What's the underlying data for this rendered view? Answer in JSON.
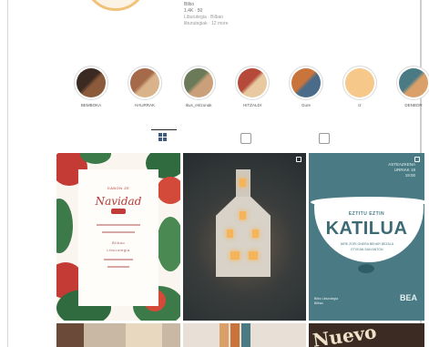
{
  "profile": {
    "name": "Bilbo",
    "stats": "1.4K · 50",
    "bio": "Liburutegia · Bilbao",
    "followed_by": "liburutegiak · 12 more"
  },
  "highlights": [
    {
      "label": "BEMBOKA",
      "icon": "highlight-cover",
      "colors": [
        "#3a2a22",
        "#8a5a3a"
      ]
    },
    {
      "label": "HAURRAK",
      "icon": "highlight-cover",
      "colors": [
        "#a46a4a",
        "#d9b48a"
      ]
    },
    {
      "label": "Ikus_entzunak",
      "icon": "highlight-cover",
      "colors": [
        "#6b7b5a",
        "#c9a07a"
      ]
    },
    {
      "label": "HITZALDI",
      "icon": "highlight-cover",
      "colors": [
        "#b54a3a",
        "#e8c9a0"
      ]
    },
    {
      "label": "Gure",
      "icon": "highlight-cover",
      "colors": [
        "#c9743a",
        "#4a6b8a"
      ]
    },
    {
      "label": "Iz",
      "icon": "highlight-cover",
      "colors": [
        "#f6c98a",
        "#f6c98a"
      ]
    },
    {
      "label": "DENBOR",
      "icon": "highlight-cover",
      "colors": [
        "#4a7b85",
        "#d9a06a"
      ]
    }
  ],
  "tabs": [
    {
      "name": "posts",
      "icon": "grid-icon",
      "active": true
    },
    {
      "name": "reels",
      "icon": "reels-icon",
      "active": false
    },
    {
      "name": "tagged",
      "icon": "tagged-icon",
      "active": false
    }
  ],
  "posts": {
    "p1": {
      "kicker": "GABON ZE",
      "title": "Navidad",
      "badge": "",
      "lines": [
        "Bilbao",
        "Liburutegia"
      ]
    },
    "p3": {
      "kicker_lines": [
        "ASTEAZKENA",
        "URRIAK 18",
        "19:00"
      ],
      "subtitle": "EZTITU EZTIN",
      "title": "KATILUA",
      "desc_lines": [
        "NIRE ZORI ONERA BEHAR BEZALA",
        "ETXEAN SAN ANTON"
      ],
      "footer_lines": [
        "Bilbo Liburutegia",
        "Bilbao"
      ],
      "logo": "BEA"
    },
    "p6": {
      "word": "Nuevo"
    }
  },
  "colors": {
    "accent": "#3d5a80",
    "teal": "#4a7b85",
    "red": "#b83a3a"
  }
}
